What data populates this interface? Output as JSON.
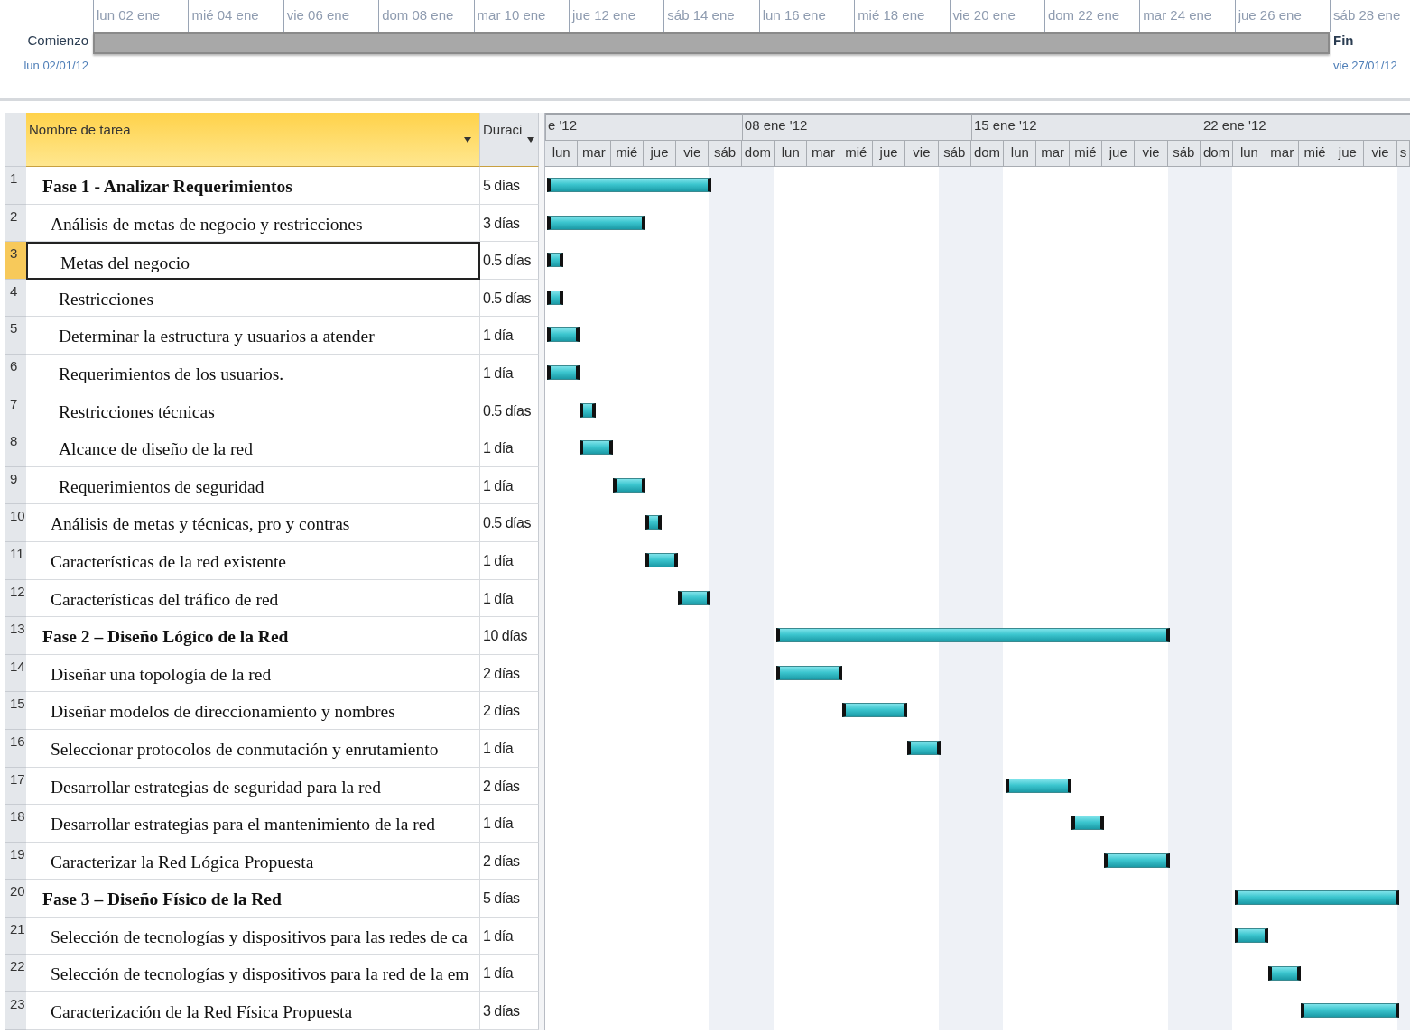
{
  "timeline": {
    "ticks": [
      "lun 02 ene",
      "mié 04 ene",
      "vie 06 ene",
      "dom 08 ene",
      "mar 10 ene",
      "jue 12 ene",
      "sáb 14 ene",
      "lun 16 ene",
      "mié 18 ene",
      "vie 20 ene",
      "dom 22 ene",
      "mar 24 ene",
      "jue 26 ene",
      "sáb 28 ene"
    ],
    "start_label": "Comienzo",
    "start_date": "lun 02/01/12",
    "end_label": "Fin",
    "end_date": "vie 27/01/12"
  },
  "table": {
    "columns": [
      {
        "label": "Nombre de tarea",
        "selected": true
      },
      {
        "label": "Duraci",
        "selected": false
      }
    ]
  },
  "gantt": {
    "weeks": [
      {
        "label": "e '12",
        "days": [
          "lun",
          "mar",
          "mié",
          "jue",
          "vie",
          "sáb"
        ]
      },
      {
        "label": "08 ene '12",
        "days": [
          "dom",
          "lun",
          "mar",
          "mié",
          "jue",
          "vie",
          "sáb"
        ]
      },
      {
        "label": "15 ene '12",
        "days": [
          "dom",
          "lun",
          "mar",
          "mié",
          "jue",
          "vie",
          "sáb"
        ]
      },
      {
        "label": "22 ene '12",
        "days": [
          "dom",
          "lun",
          "mar",
          "mié",
          "jue",
          "vie",
          "s"
        ]
      }
    ]
  },
  "tasks": [
    {
      "id": "1",
      "name": "Fase 1 - Analizar Requerimientos",
      "duration": "5 días",
      "kind": "phase",
      "selected": false,
      "children": [
        {
          "id": "2",
          "name": "Análisis de metas de negocio y restricciones",
          "duration": "3 días",
          "kind": "task",
          "selected": false,
          "children": [
            {
              "id": "3",
              "name": "Metas del negocio",
              "duration": "0.5 días",
              "kind": "task",
              "selected": true
            },
            {
              "id": "4",
              "name": "Restricciones",
              "duration": "0.5 días",
              "kind": "task",
              "selected": false
            },
            {
              "id": "5",
              "name": "Determinar la estructura y usuarios a atender",
              "duration": "1 día",
              "kind": "task",
              "selected": false
            },
            {
              "id": "6",
              "name": "Requerimientos de los usuarios.",
              "duration": "1 día",
              "kind": "task",
              "selected": false
            },
            {
              "id": "7",
              "name": "Restricciones técnicas",
              "duration": "0.5 días",
              "kind": "task",
              "selected": false
            },
            {
              "id": "8",
              "name": "Alcance de diseño de la red",
              "duration": "1 día",
              "kind": "task",
              "selected": false
            },
            {
              "id": "9",
              "name": "Requerimientos de seguridad",
              "duration": "1 día",
              "kind": "task",
              "selected": false
            }
          ]
        },
        {
          "id": "10",
          "name": "Análisis de metas y técnicas, pro y contras",
          "duration": "0.5 días",
          "kind": "task",
          "selected": false
        },
        {
          "id": "11",
          "name": "Características de la red existente",
          "duration": "1 día",
          "kind": "task",
          "selected": false
        },
        {
          "id": "12",
          "name": "Características del tráfico de red",
          "duration": "1 día",
          "kind": "task",
          "selected": false
        }
      ]
    },
    {
      "id": "13",
      "name": "Fase 2 – Diseño Lógico de la Red",
      "duration": "10 días",
      "kind": "phase",
      "selected": false,
      "children": [
        {
          "id": "14",
          "name": "Diseñar una topología de la red",
          "duration": "2 días",
          "kind": "task",
          "selected": false
        },
        {
          "id": "15",
          "name": "Diseñar modelos de direccionamiento y nombres",
          "duration": "2 días",
          "kind": "task",
          "selected": false
        },
        {
          "id": "16",
          "name": "Seleccionar protocolos de conmutación y enrutamiento",
          "duration": "1 día",
          "kind": "task",
          "selected": false
        },
        {
          "id": "17",
          "name": "Desarrollar estrategias de seguridad para la red",
          "duration": "2 días",
          "kind": "task",
          "selected": false
        },
        {
          "id": "18",
          "name": "Desarrollar estrategias para el mantenimiento de la red",
          "duration": "1 día",
          "kind": "task",
          "selected": false
        },
        {
          "id": "19",
          "name": "Caracterizar la Red Lógica Propuesta",
          "duration": "2 días",
          "kind": "task",
          "selected": false
        }
      ]
    },
    {
      "id": "20",
      "name": "Fase 3 – Diseño Físico de la Red",
      "duration": "5 días",
      "kind": "phase",
      "selected": false,
      "children": [
        {
          "id": "21",
          "name": "Selección de tecnologías y dispositivos para las redes de ca",
          "duration": "1 día",
          "kind": "task",
          "selected": false
        },
        {
          "id": "22",
          "name": "Selección de tecnologías y dispositivos para la red de la em",
          "duration": "1 día",
          "kind": "task",
          "selected": false
        },
        {
          "id": "23",
          "name": "Caracterización de la Red Física Propuesta",
          "duration": "3 días",
          "kind": "task",
          "selected": false
        }
      ]
    }
  ]
}
